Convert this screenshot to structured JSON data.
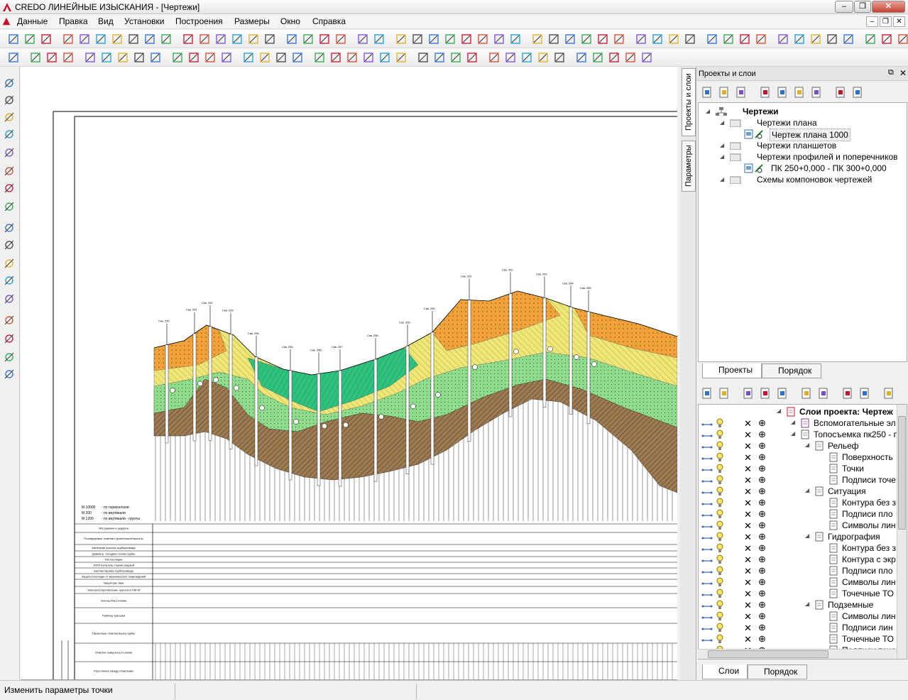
{
  "window": {
    "title": "CREDO ЛИНЕЙНЫЕ ИЗЫСКАНИЯ - [Чертежи]"
  },
  "menu": [
    "Данные",
    "Правка",
    "Вид",
    "Установки",
    "Построения",
    "Размеры",
    "Окно",
    "Справка"
  ],
  "side_tabs": {
    "projects": "Проекты и слои",
    "params": "Параметры"
  },
  "panel": {
    "title": "Проекты и слои",
    "tree": [
      {
        "label": "Чертежи",
        "bold": true,
        "level": 0
      },
      {
        "label": "Чертежи плана",
        "level": 1
      },
      {
        "label": "Чертеж плана 1000",
        "level": 2,
        "selected": true
      },
      {
        "label": "Чертежи планшетов",
        "level": 1
      },
      {
        "label": "Чертежи профилей и поперечников",
        "level": 1
      },
      {
        "label": "ПК 250+0,000 - ПК 300+0,000",
        "level": 2
      },
      {
        "label": "Схемы компоновок чертежей",
        "level": 1
      }
    ],
    "tabs_top": [
      "Проекты",
      "Порядок"
    ],
    "layers": [
      {
        "label": "Слои проекта: Чертеж",
        "bold": true,
        "level": 0
      },
      {
        "label": "Вспомогательные эл",
        "level": 1
      },
      {
        "label": "Топосъемка пк250 - п",
        "level": 1
      },
      {
        "label": "Рельеф",
        "level": 2
      },
      {
        "label": "Поверхность",
        "level": 3
      },
      {
        "label": "Точки",
        "level": 3
      },
      {
        "label": "Подписи точе",
        "level": 3
      },
      {
        "label": "Ситуация",
        "level": 2
      },
      {
        "label": "Контура без з",
        "level": 3
      },
      {
        "label": "Подписи пло",
        "level": 3
      },
      {
        "label": "Символы лин",
        "level": 3
      },
      {
        "label": "Гидрография",
        "level": 2
      },
      {
        "label": "Контура без з",
        "level": 3
      },
      {
        "label": "Контура с экр",
        "level": 3
      },
      {
        "label": "Подписи пло",
        "level": 3
      },
      {
        "label": "Символы лин",
        "level": 3
      },
      {
        "label": "Точечные ТО",
        "level": 3
      },
      {
        "label": "Подземные",
        "level": 2
      },
      {
        "label": "Символы лин",
        "level": 3
      },
      {
        "label": "Подписи лин",
        "level": 3
      },
      {
        "label": "Точечные ТО",
        "level": 3
      },
      {
        "label": "Подписи точе",
        "level": 3
      }
    ],
    "tabs_bottom": [
      "Слои",
      "Порядок"
    ]
  },
  "drawing": {
    "scale_lines": [
      {
        "scale": "М 10000",
        "desc": "- по горизонтали"
      },
      {
        "scale": "М 200",
        "desc": "- по вертикали"
      },
      {
        "scale": "М 1200",
        "desc": "- по вертикали - грунты"
      }
    ],
    "table_rows": [
      "NN скважин и шурфов",
      "Планируемые отметки строительной высоты",
      "Категория участка трубопровода",
      "Диаметр, толщина стенки трубы",
      "Тип изоляции",
      "100% контроль стыков сваркой",
      "Балластировка трубопровода",
      "Защита изоляции от механических повреждений",
      "Защитные сваи",
      "Электросопротивление грунтов в ОМ·М",
      "Уклоны Расстояние",
      "Глубина траншеи",
      "Проектные отметки верха трубы",
      "Отметки поверхности земли",
      "Расстояние между отметками"
    ],
    "boreholes": [
      "Скв. 250",
      "Скв. 251",
      "Скв. 252",
      "Скв. 253",
      "Скв. 254",
      "Скв. 255",
      "Скв. 256",
      "Скв. 257",
      "Скв. 258",
      "Скв. 259",
      "Скв. 260",
      "Скв. 261",
      "Скв. 262",
      "Скв. 263",
      "Скв. 264",
      "Скв. 265"
    ]
  },
  "status": {
    "text": "Изменить параметры точки"
  }
}
